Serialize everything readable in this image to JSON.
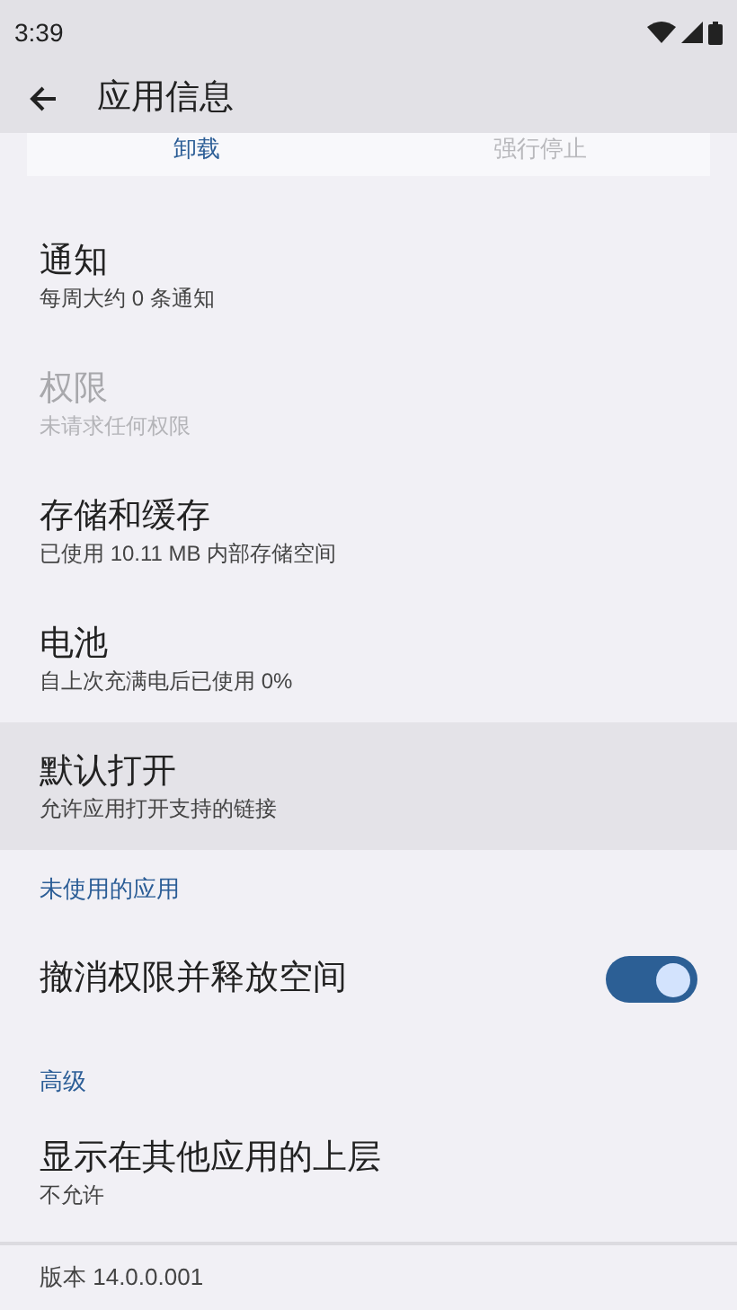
{
  "status_bar": {
    "time": "3:39"
  },
  "header": {
    "title": "应用信息"
  },
  "actions": [
    {
      "label": "卸载",
      "disabled": false
    },
    {
      "label": "强行停止",
      "disabled": true
    }
  ],
  "items": [
    {
      "kind": "entry",
      "title": "通知",
      "subtitle": "每周大约 0 条通知",
      "disabled": false,
      "selected": false
    },
    {
      "kind": "entry",
      "title": "权限",
      "subtitle": "未请求任何权限",
      "disabled": true,
      "selected": false
    },
    {
      "kind": "entry",
      "title": "存储和缓存",
      "subtitle": "已使用 10.11 MB 内部存储空间",
      "disabled": false,
      "selected": false
    },
    {
      "kind": "entry",
      "title": "电池",
      "subtitle": "自上次充满电后已使用 0%",
      "disabled": false,
      "selected": false
    },
    {
      "kind": "entry",
      "title": "默认打开",
      "subtitle": "允许应用打开支持的链接",
      "disabled": false,
      "selected": true
    },
    {
      "kind": "section",
      "title": "未使用的应用"
    },
    {
      "kind": "switch",
      "title": "撤消权限并释放空间",
      "on": true
    },
    {
      "kind": "section",
      "title": "高级"
    },
    {
      "kind": "entry",
      "title": "显示在其他应用的上层",
      "subtitle": "不允许",
      "disabled": false,
      "selected": false
    }
  ],
  "footer": {
    "version": "版本 14.0.0.001"
  }
}
